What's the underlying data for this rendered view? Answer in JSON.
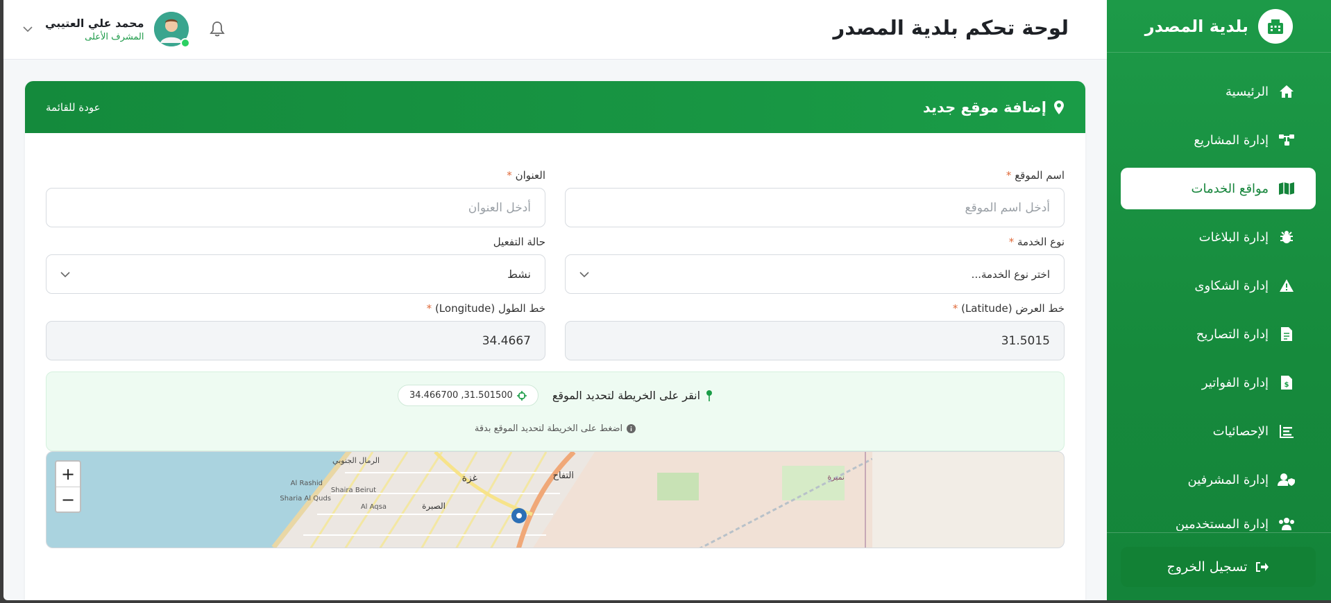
{
  "brand": {
    "title": "بلدية المصدر",
    "logo_icon": "city-icon"
  },
  "sidebar": {
    "items": [
      {
        "label": "الرئيسية",
        "icon": "home-icon"
      },
      {
        "label": "إدارة المشاريع",
        "icon": "project-diagram-icon"
      },
      {
        "label": "مواقع الخدمات",
        "icon": "map-icon",
        "active": true
      },
      {
        "label": "إدارة البلاغات",
        "icon": "bug-icon"
      },
      {
        "label": "إدارة الشكاوى",
        "icon": "warning-icon"
      },
      {
        "label": "إدارة التصاريح",
        "icon": "file-icon"
      },
      {
        "label": "إدارة الفواتير",
        "icon": "invoice-icon"
      },
      {
        "label": "الإحصائيات",
        "icon": "chart-icon"
      },
      {
        "label": "إدارة المشرفين",
        "icon": "user-shield-icon"
      },
      {
        "label": "إدارة المستخدمين",
        "icon": "users-icon"
      }
    ],
    "logout_label": "تسجيل الخروج"
  },
  "header": {
    "title": "لوحة تحكم بلدية المصدر",
    "user_name": "محمد علي العتيبي",
    "user_role": "المشرف الأعلى"
  },
  "card": {
    "title": "إضافة موقع جديد",
    "back_label": "عودة للقائمة"
  },
  "form": {
    "site_name": {
      "label": "اسم الموقع",
      "required": "*",
      "placeholder": "أدخل اسم الموقع"
    },
    "address": {
      "label": "العنوان",
      "required": "*",
      "placeholder": "أدخل العنوان"
    },
    "service_type": {
      "label": "نوع الخدمة",
      "required": "*",
      "value": "اختر نوع الخدمة..."
    },
    "status": {
      "label": "حالة التفعيل",
      "value": "نشط"
    },
    "latitude": {
      "label": "خط العرض (Latitude)",
      "required": "*",
      "value": "31.5015"
    },
    "longitude": {
      "label": "خط الطول (Longitude)",
      "required": "*",
      "value": "34.4667"
    }
  },
  "map_hint": {
    "title": "انقر على الخريطة لتحديد الموقع",
    "coords": "34.466700 ,31.501500",
    "subtitle": "اضغط على الخريطة لتحديد الموقع بدقة"
  },
  "map": {
    "zoom_in": "+",
    "zoom_out": "−",
    "labels": [
      "غزة",
      "الرمال الجنوبي",
      "التفاح",
      "الصبرة",
      "Shaira Beirut",
      "Al Aqsa",
      "Sharia Al Quds",
      "Al Rashid",
      "نميرة"
    ]
  },
  "colors": {
    "primary": "#1a9c47",
    "accent": "#e06a3a"
  }
}
